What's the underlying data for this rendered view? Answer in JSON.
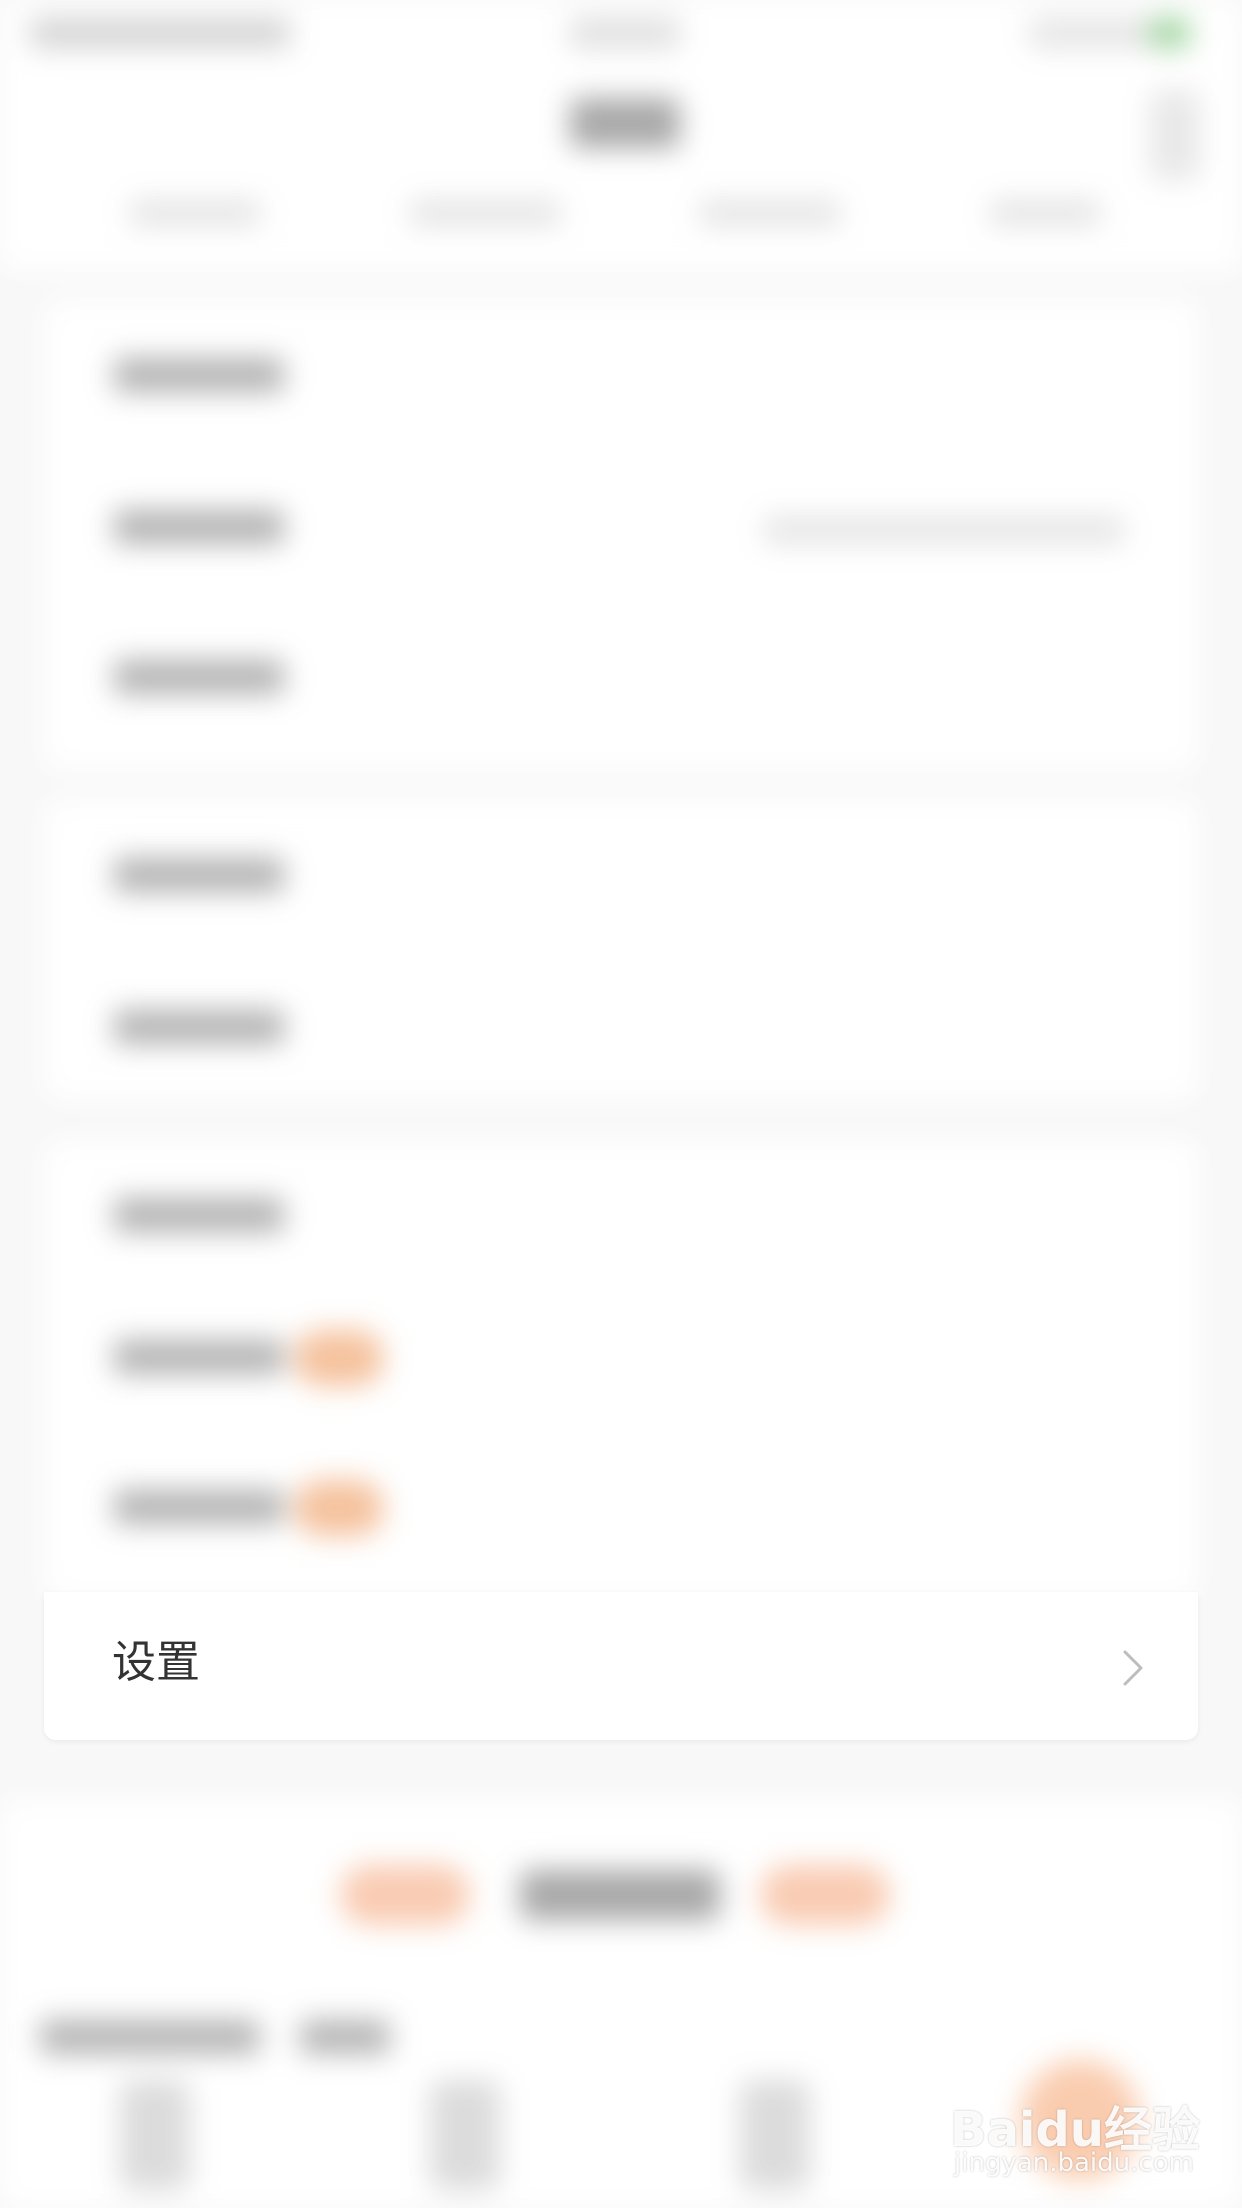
{
  "settings_row": {
    "label": "设置"
  },
  "icons": {
    "chevron": "chevron-right-icon"
  },
  "watermark": {
    "text": "Baidu经验",
    "sub": "jingyan.baidu.com"
  },
  "colors": {
    "accent_orange": "#f0a26a",
    "text_primary": "#333333",
    "chevron": "#bdbdbd",
    "background": "#f4f4f4"
  }
}
